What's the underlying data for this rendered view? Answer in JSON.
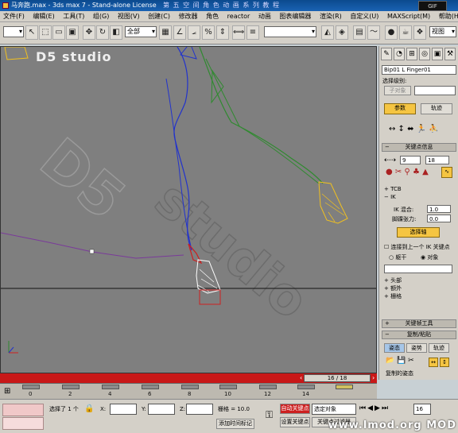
{
  "titlebar": {
    "title": "马奔跑.max - 3ds max 7 - Stand-alone License",
    "course_title": "第 五 空 间 角 色 动 画 系 列 教 程",
    "gif_badge": "GIF"
  },
  "menubar": {
    "items": [
      "文件(F)",
      "编辑(E)",
      "工具(T)",
      "组(G)",
      "视图(V)",
      "创建(C)",
      "修改器",
      "角色",
      "reactor",
      "动画",
      "图表编辑器",
      "渲染(R)",
      "自定义(U)",
      "MAXScript(M)",
      "帮助(H)"
    ]
  },
  "toolbar": {
    "selection_filter": "全部",
    "view_dropdown": "视图",
    "named_set_dropdown": "",
    "right_label": "视图"
  },
  "viewport": {
    "label": "D5 studio",
    "watermark": "D5 studio"
  },
  "colors": {
    "spine_blue": "#2233cc",
    "leg_green": "#2f8a2f",
    "hoof_yellow": "#f0c020",
    "hoof_white": "#ffffff",
    "trajectory_purple": "#7a3a9a",
    "selected_red": "#cc2020",
    "timebar_red": "#c81818"
  },
  "command_panel": {
    "object_name": "Bip01 L Finger01",
    "selection_level_label": "选择级别:",
    "sub_object_label": "子对象",
    "tabs": [
      "参数",
      "轨迹"
    ],
    "key_info_title": "关键点信息",
    "key_number": "9",
    "key_frame": "18",
    "tcb_label": "TCB",
    "ik_label": "IK",
    "ik_blend_label": "IK 混合:",
    "ik_blend_value": "1.0",
    "ankle_tension_label": "脚踝张力:",
    "ankle_tension_value": "0.0",
    "select_pivot_button": "选择轴",
    "join_prev_ik_label": "连接到上一个 IK 关键点",
    "body_label": "躯干",
    "object_label": "对象",
    "head_label": "头部",
    "extra_labels": [
      "额外",
      "栅格"
    ],
    "key_tools_title": "关键帧工具",
    "copy_paste_title": "复制/粘贴",
    "copy_tabs": [
      "姿态",
      "姿势",
      "轨迹"
    ],
    "copy_collection_label": "复制的姿态"
  },
  "timeline": {
    "slider_text": "16 / 18",
    "current_frame": 16,
    "total_frames": 18,
    "tick_labels": [
      "0",
      "2",
      "4",
      "6",
      "8",
      "10",
      "12",
      "14"
    ]
  },
  "statusbar": {
    "selected_text": "选择了 1 个",
    "x_label": "X:",
    "y_label": "Y:",
    "z_label": "Z:",
    "grid_text": "栅格 = 10.0",
    "add_time_tag": "添加时间标记",
    "auto_key": "自动关键点",
    "set_key": "设置关键点",
    "selection_dropdown": "选定对象",
    "key_filters": "关键点过滤器",
    "frame_value": "16"
  },
  "watermark_logo": "www.lmod.org MOD"
}
